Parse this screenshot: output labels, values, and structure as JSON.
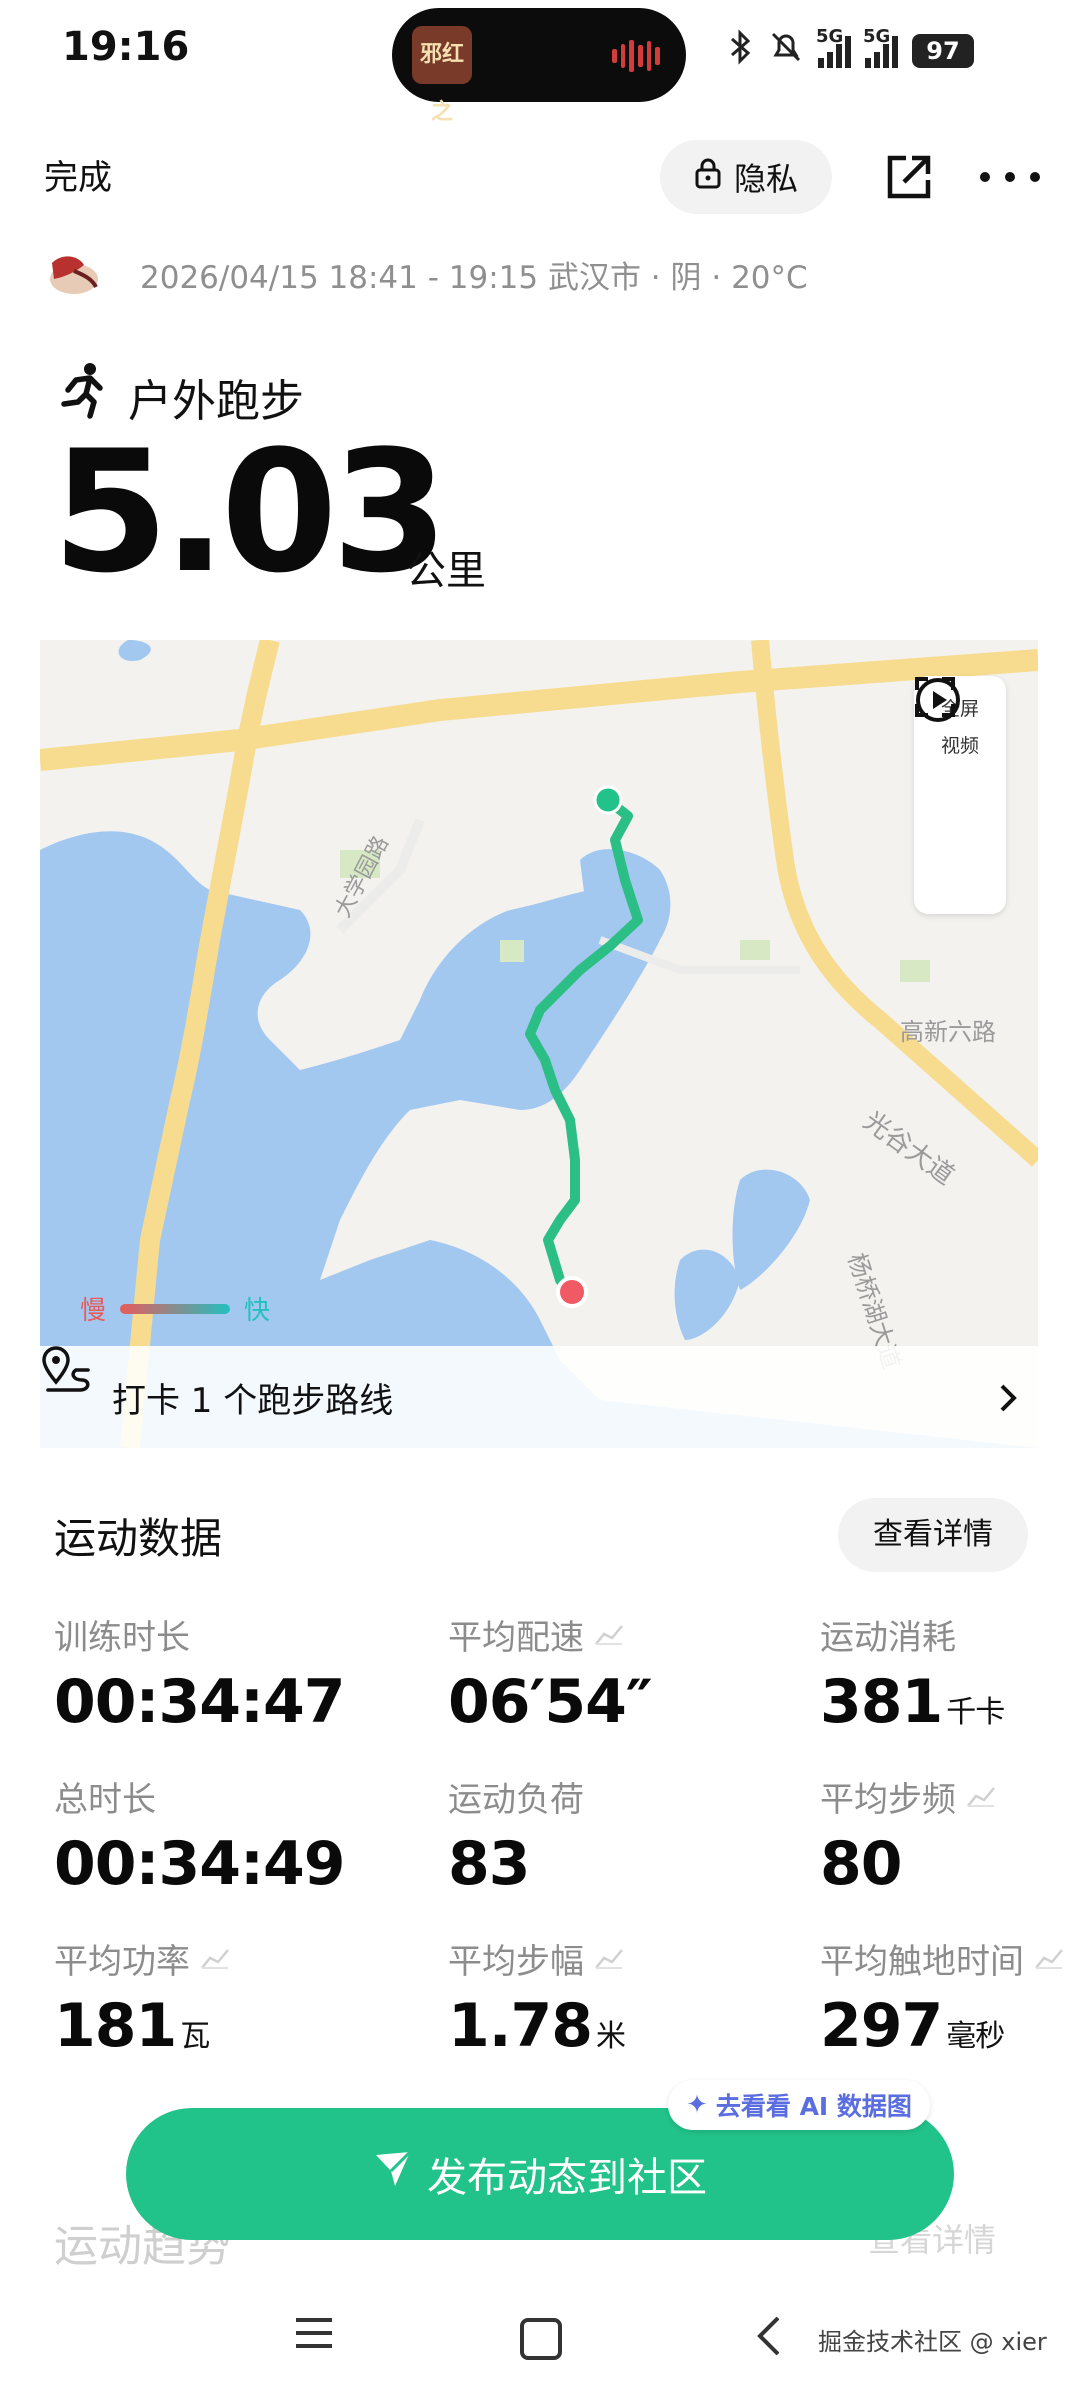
{
  "status": {
    "time": "19:16",
    "battery": "97",
    "signal_label": "5G",
    "island_text": "邪红之"
  },
  "header": {
    "done_label": "完成",
    "privacy_label": "隐私"
  },
  "meta": {
    "text": "2026/04/15 18:41 - 19:15 武汉市 · 阴 · 20°C"
  },
  "activity": {
    "type_label": "户外跑步",
    "distance": "5.03",
    "distance_unit": "公里"
  },
  "map": {
    "fullscreen_label": "全屏",
    "video_label": "视频",
    "slow_label": "慢",
    "fast_label": "快",
    "road_labels": [
      "大学园路",
      "高新六路",
      "光谷大道",
      "杨桥湖大道"
    ],
    "checkin_label": "打卡 1 个跑步路线"
  },
  "stats": {
    "section_title": "运动数据",
    "detail_label": "查看详情",
    "items": [
      {
        "label": "训练时长",
        "value": "00:34:47",
        "unit": "",
        "chart_icon": false
      },
      {
        "label": "平均配速",
        "value": "06′54″",
        "unit": "",
        "chart_icon": true
      },
      {
        "label": "运动消耗",
        "value": "381",
        "unit": "千卡",
        "chart_icon": false
      },
      {
        "label": "总时长",
        "value": "00:34:49",
        "unit": "",
        "chart_icon": false
      },
      {
        "label": "运动负荷",
        "value": "83",
        "unit": "",
        "chart_icon": false
      },
      {
        "label": "平均步频",
        "value": "80",
        "unit": "",
        "chart_icon": true
      },
      {
        "label": "平均功率",
        "value": "181",
        "unit": "瓦",
        "chart_icon": true
      },
      {
        "label": "平均步幅",
        "value": "1.78",
        "unit": "米",
        "chart_icon": true
      },
      {
        "label": "平均触地时间",
        "value": "297",
        "unit": "毫秒",
        "chart_icon": true
      }
    ]
  },
  "bottom": {
    "ai_chip_label": "去看看 AI 数据图",
    "publish_label": "发布动态到社区",
    "faded_title": "运动趋势",
    "faded_detail": "查看详情"
  },
  "watermark": "掘金技术社区 @ xier",
  "colors": {
    "accent_green": "#22c38a",
    "water_blue": "#a3c8f0",
    "road_yellow": "#f7dc8f",
    "start_dot": "#22c38a",
    "end_dot": "#f05a64"
  }
}
